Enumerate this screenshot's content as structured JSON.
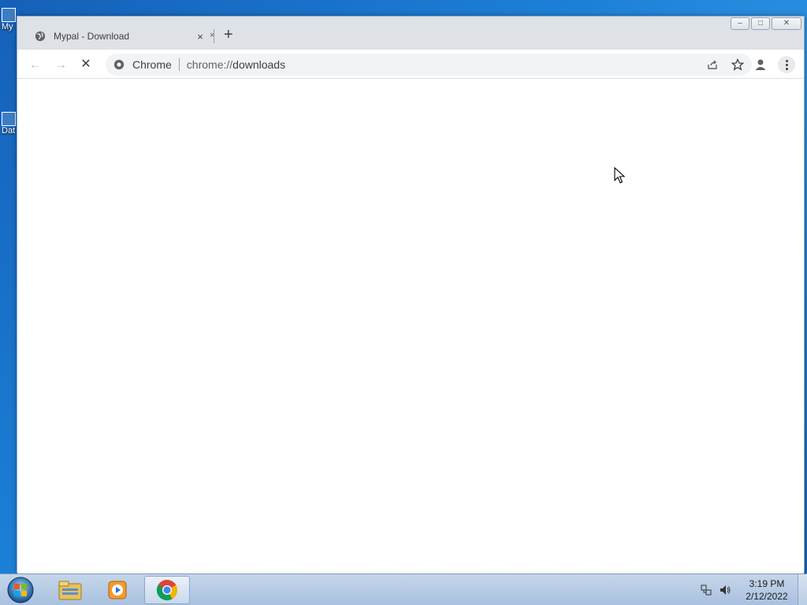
{
  "desktop": {
    "icons": [
      {
        "label": "My"
      },
      {
        "label": "Dat"
      }
    ]
  },
  "browser": {
    "tab": {
      "title": "Mypal - Download",
      "close_glyph": "×",
      "icon": "globe-icon"
    },
    "new_tab_glyph": "+",
    "window_controls": {
      "minimize": "–",
      "maximize": "□",
      "close": "✕"
    },
    "toolbar": {
      "back_glyph": "←",
      "forward_glyph": "→",
      "stop_glyph": "✕"
    },
    "omnibox": {
      "chip": "Chrome",
      "url_prefix": "chrome://",
      "url_rest": "downloads"
    }
  },
  "taskbar": {
    "pinned": [
      "windows-explorer-icon",
      "media-player-icon",
      "chrome-icon"
    ],
    "active": "chrome-icon",
    "clock": {
      "time": "3:19 PM",
      "date": "2/12/2022"
    }
  },
  "colors": {
    "desktop_blue": "#1c7fd6",
    "tabstrip": "#dee1e6",
    "omnibox_bg": "#f1f3f4"
  }
}
